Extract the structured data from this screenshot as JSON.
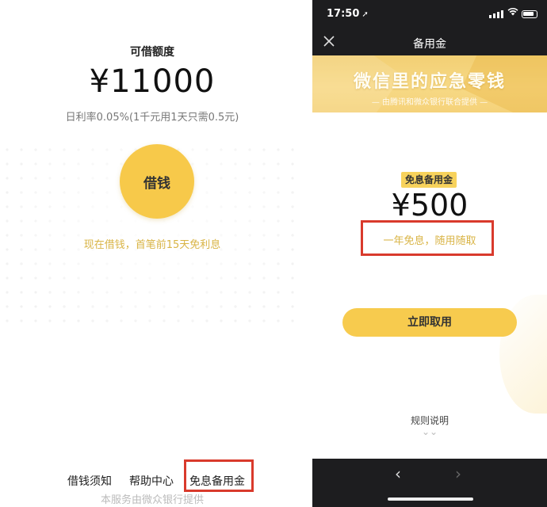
{
  "left": {
    "credit_label": "可借额度",
    "credit_amount": "¥11000",
    "rate_text": "日利率0.05%(1千元用1天只需0.5元)",
    "borrow_button": "借钱",
    "promo_text": "现在借钱，首笔前15天免利息",
    "links": [
      "借钱须知",
      "帮助中心",
      "免息备用金"
    ],
    "footer_note": "本服务由微众银行提供"
  },
  "right": {
    "status": {
      "time": "17:50",
      "time_arrow": "➚"
    },
    "nav": {
      "close_icon": "close-icon",
      "title": "备用金"
    },
    "banner": {
      "title": "微信里的应急零钱",
      "subtitle": "— 由腾讯和微众银行联合提供 —"
    },
    "badge": "免息备用金",
    "amount": "¥500",
    "desc": "一年免息，随用随取",
    "take_button": "立即取用",
    "rules": "规则说明",
    "rules_chevron": "⌄⌄",
    "back_icon": "‹",
    "forward_icon": "›"
  },
  "colors": {
    "accent_yellow": "#f7c94a",
    "promo_gold": "#d9b445",
    "highlight_red": "#d93a2c",
    "dark_bar": "#1d1d1f"
  }
}
